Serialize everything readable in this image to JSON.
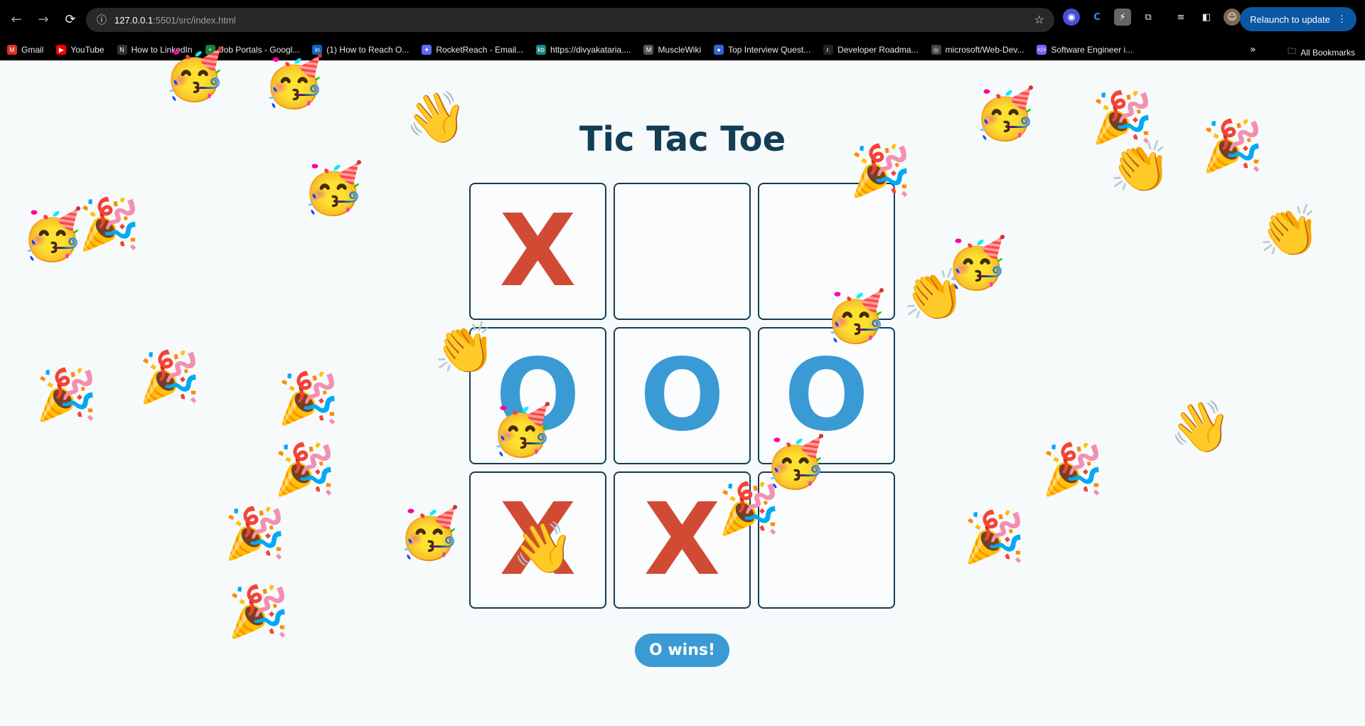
{
  "browser": {
    "url_host": "127.0.0.1",
    "url_rest": ":5501/src/index.html",
    "relaunch_label": "Relaunch to update",
    "bookmarks": [
      {
        "label": "Gmail",
        "fav": "M",
        "color": "#d93025"
      },
      {
        "label": "YouTube",
        "fav": "▶",
        "color": "#ff0000"
      },
      {
        "label": "How to LinkedIn",
        "fav": "N",
        "color": "#333333"
      },
      {
        "label": "Job Portals - Googl...",
        "fav": "+",
        "color": "#188038"
      },
      {
        "label": "(1) How to Reach O...",
        "fav": "in",
        "color": "#0a66c2"
      },
      {
        "label": "RocketReach - Email...",
        "fav": "✦",
        "color": "#5f6bff"
      },
      {
        "label": "https://divyakataria....",
        "fav": "kb",
        "color": "#138a86"
      },
      {
        "label": "MuscleWiki",
        "fav": "M",
        "color": "#555555"
      },
      {
        "label": "Top Interview Quest...",
        "fav": "●",
        "color": "#3367d6"
      },
      {
        "label": "Developer Roadma...",
        "fav": "r.",
        "color": "#222222"
      },
      {
        "label": "microsoft/Web-Dev...",
        "fav": "◎",
        "color": "#444444"
      },
      {
        "label": "Software Engineer i...",
        "fav": "</>",
        "color": "#7b61ff"
      }
    ],
    "all_bookmarks_label": "All Bookmarks"
  },
  "game": {
    "title": "Tic Tac Toe",
    "cells": [
      "X",
      "",
      "",
      "O",
      "O",
      "O",
      "X",
      "X",
      ""
    ],
    "status": "O wins!"
  },
  "colors": {
    "x": "#d14b34",
    "o": "#3a9ad4",
    "title": "#133c55"
  }
}
